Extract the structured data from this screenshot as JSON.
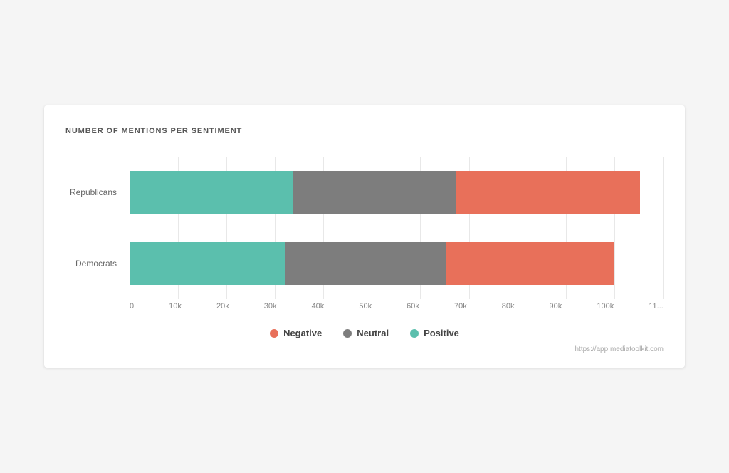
{
  "chart": {
    "title": "NUMBER OF MENTIONS PER SENTIMENT",
    "bars": [
      {
        "label": "Republicans",
        "positive_pct": 31.5,
        "neutral_pct": 31.5,
        "negative_pct": 35.5
      },
      {
        "label": "Democrats",
        "positive_pct": 31.0,
        "neutral_pct": 32.0,
        "negative_pct": 33.5
      }
    ],
    "x_labels": [
      "0",
      "10k",
      "20k",
      "30k",
      "40k",
      "50k",
      "60k",
      "70k",
      "80k",
      "90k",
      "100k",
      "11..."
    ],
    "legend": [
      {
        "label": "Negative",
        "color": "#e8705a"
      },
      {
        "label": "Neutral",
        "color": "#7d7d7d"
      },
      {
        "label": "Positive",
        "color": "#5bbfad"
      }
    ],
    "footer_url": "https://app.mediatoolkit.com",
    "colors": {
      "positive": "#5bbfad",
      "neutral": "#7d7d7d",
      "negative": "#e8705a"
    }
  }
}
